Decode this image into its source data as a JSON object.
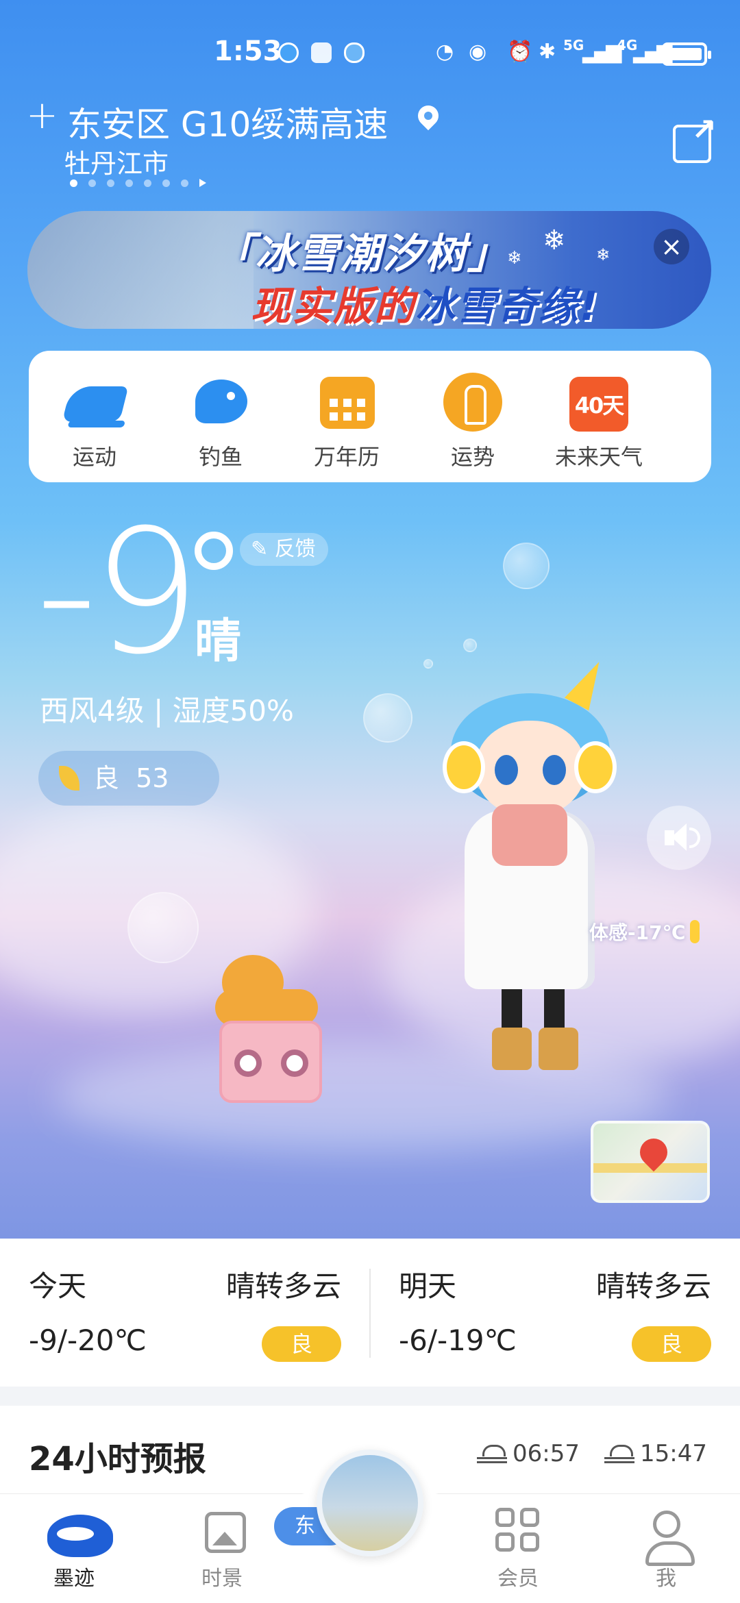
{
  "status_bar": {
    "time": "1:53",
    "network_5g": "5G",
    "network_4g": "4G"
  },
  "header": {
    "location": "东安区 G10绥满高速",
    "city": "牡丹江市",
    "page_count": 7,
    "active_page": 1
  },
  "banner": {
    "line1": "「冰雪潮汐树」",
    "line2_red": "现实版的",
    "line2_blue": "冰雪奇缘!"
  },
  "shortcuts": [
    {
      "label": "运动",
      "icon": "shoe-icon"
    },
    {
      "label": "钓鱼",
      "icon": "fish-icon"
    },
    {
      "label": "万年历",
      "icon": "calendar-icon"
    },
    {
      "label": "运势",
      "icon": "fortune-icon"
    },
    {
      "label": "未来天气",
      "icon": "forecast-40-day-icon",
      "badge": "40天"
    }
  ],
  "current": {
    "temperature": "-9",
    "condition": "晴",
    "feedback_label": "反馈",
    "wind_humidity": "西风4级 | 湿度50%",
    "aqi_label": "良",
    "aqi_value": "53",
    "feels_like": "体感-17℃"
  },
  "daily": [
    {
      "day": "今天",
      "desc": "晴转多云",
      "range": "-9/-20℃",
      "aqi": "良"
    },
    {
      "day": "明天",
      "desc": "晴转多云",
      "range": "-6/-19℃",
      "aqi": "良"
    }
  ],
  "forecast_24h": {
    "title": "24小时预报",
    "sunrise": "06:57",
    "sunset": "15:47"
  },
  "bottom_nav": [
    {
      "label": "墨迹",
      "icon": "moji-logo-icon",
      "active": true
    },
    {
      "label": "时景",
      "icon": "photo-icon",
      "active": false
    },
    {
      "label": "会员",
      "icon": "grid-icon",
      "active": false
    },
    {
      "label": "我",
      "icon": "profile-icon",
      "active": false
    }
  ],
  "nav_stub_text": "东"
}
